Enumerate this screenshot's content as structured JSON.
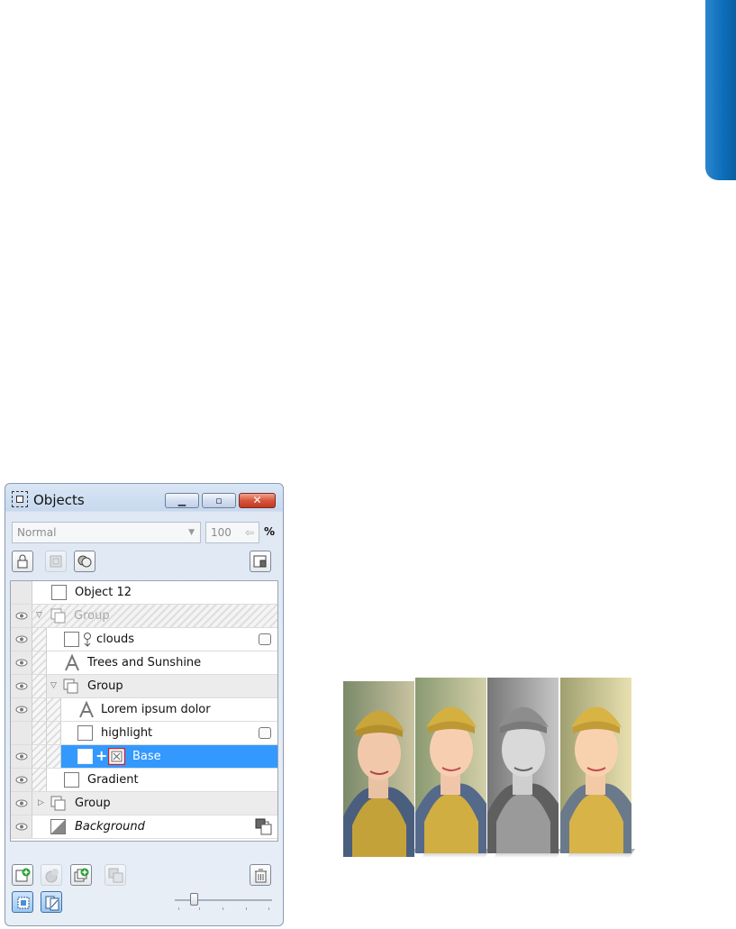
{
  "window": {
    "title": "Objects",
    "buttons": {
      "minimize": "minimize",
      "maximize": "maximize",
      "close": "close"
    }
  },
  "blend_mode": {
    "value": "Normal"
  },
  "opacity": {
    "value": "100",
    "unit": "%"
  },
  "toolbar": {
    "icons": [
      "lock-icon",
      "mask-icon",
      "overlap-icon",
      "properties-icon"
    ]
  },
  "objects": [
    {
      "label": "Object 12",
      "visible": false,
      "type": "object"
    },
    {
      "label": "Group",
      "visible": true,
      "type": "group",
      "expanded": true,
      "dimmed": true
    },
    {
      "label": "clouds",
      "visible": true,
      "type": "object",
      "linked": true,
      "mask": true
    },
    {
      "label": "Trees and Sunshine",
      "visible": true,
      "type": "text"
    },
    {
      "label": "Group",
      "visible": true,
      "type": "group",
      "expanded": true
    },
    {
      "label": "Lorem ipsum dolor",
      "visible": true,
      "type": "text"
    },
    {
      "label": "highlight",
      "visible": false,
      "type": "object",
      "mask": true
    },
    {
      "label": "Base",
      "visible": true,
      "type": "object",
      "selected": true,
      "has_mask": true
    },
    {
      "label": "Gradient",
      "visible": true,
      "type": "object"
    },
    {
      "label": "Group",
      "visible": true,
      "type": "group",
      "expanded": false
    },
    {
      "label": "Background",
      "visible": true,
      "type": "background"
    }
  ],
  "bottom_toolbar": {
    "icons": [
      "new-object-icon",
      "new-mask-icon",
      "new-object-from-selection-icon",
      "combine-icon",
      "delete-icon"
    ]
  },
  "view_toolbar": {
    "icons": [
      "single-view-icon",
      "multi-view-icon"
    ],
    "thumbnail_size": 0.2
  },
  "colors": {
    "accent_tab": "#0d6db8",
    "selection": "#3399ff",
    "close_button": "#d8543a"
  }
}
